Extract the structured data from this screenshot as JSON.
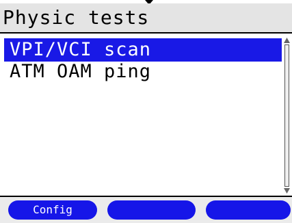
{
  "screen": {
    "title": "Physic tests"
  },
  "menu": {
    "items": [
      {
        "label": "VPI/VCI scan",
        "selected": true
      },
      {
        "label": "ATM OAM ping",
        "selected": false
      }
    ]
  },
  "softkeys": [
    {
      "label": "Config"
    },
    {
      "label": ""
    },
    {
      "label": ""
    }
  ],
  "colors": {
    "selection": "#1919e6",
    "softkey": "#1616e8",
    "title_bar": "#e4e4e4"
  },
  "icons": {
    "top_indicator": "down-arrow-icon",
    "scroll_up": "scroll-up-arrow-icon",
    "scroll_down": "scroll-down-arrow-icon"
  }
}
